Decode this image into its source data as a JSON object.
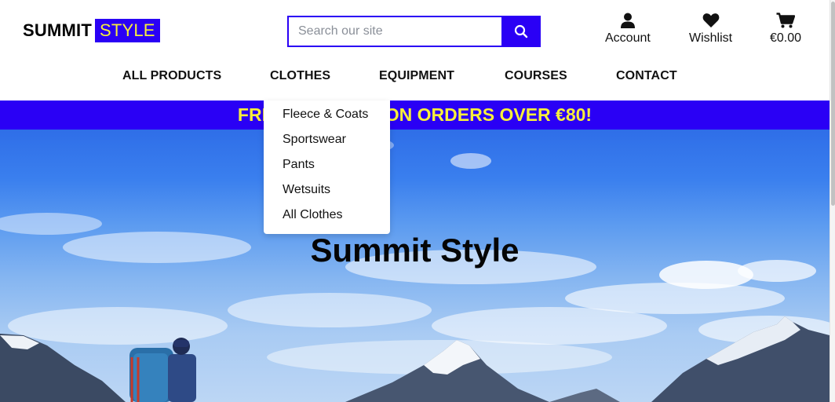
{
  "logo": {
    "word1": "SUMMIT",
    "word2": "STYLE"
  },
  "search": {
    "placeholder": "Search our site",
    "value": "",
    "icon": "search-icon"
  },
  "header_links": {
    "account": {
      "label": "Account",
      "icon": "user-icon"
    },
    "wishlist": {
      "label": "Wishlist",
      "icon": "heart-icon"
    },
    "cart": {
      "label": "€0.00",
      "icon": "cart-icon"
    }
  },
  "nav": {
    "all_products": "ALL PRODUCTS",
    "clothes": "CLOTHES",
    "equipment": "EQUIPMENT",
    "courses": "COURSES",
    "contact": "CONTACT"
  },
  "dropdown": {
    "items": [
      "Fleece & Coats",
      "Sportswear",
      "Pants",
      "Wetsuits",
      "All Clothes"
    ]
  },
  "banner": {
    "text": "FREE DELIVERY ON ORDERS OVER €80!"
  },
  "hero": {
    "title": "Summit Style"
  },
  "colors": {
    "brand": "#2a00f5",
    "accent": "#f7ef3c"
  }
}
